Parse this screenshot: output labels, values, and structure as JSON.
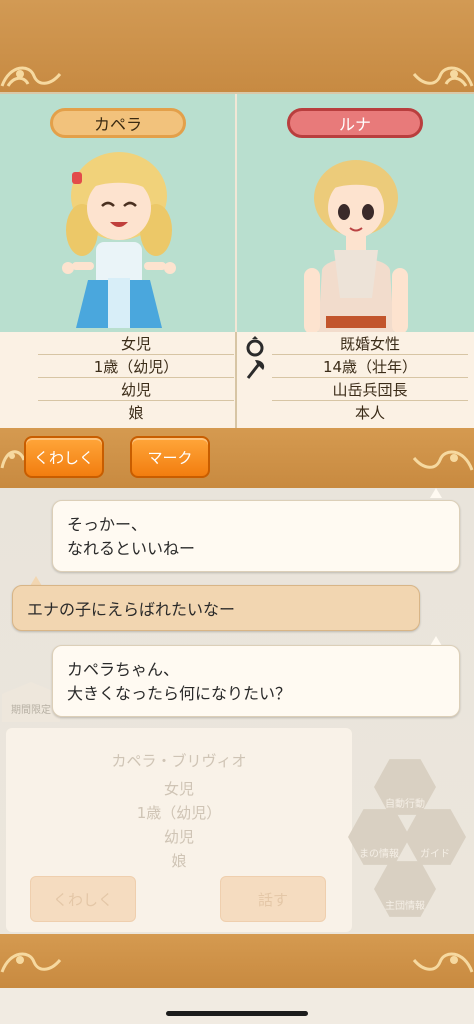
{
  "characters": {
    "left": {
      "name": "カペラ",
      "info": [
        "女児",
        "1歳（幼児）",
        "幼児",
        "娘"
      ]
    },
    "right": {
      "name": "ルナ",
      "info": [
        "既婚女性",
        "14歳（壮年）",
        "山岳兵団長",
        "本人"
      ]
    }
  },
  "icons": {
    "ring": "ring-icon",
    "axe": "axe-icon"
  },
  "buttons": {
    "details": "くわしく",
    "mark": "マーク"
  },
  "chat": {
    "messages": [
      {
        "speaker": "other",
        "lines": [
          "そっかー、",
          "なれるといいねー"
        ]
      },
      {
        "speaker": "self",
        "lines": [
          "エナの子にえらばれたいなー"
        ]
      },
      {
        "speaker": "other",
        "lines": [
          "カペラちゃん、",
          "大きくなったら何になりたい？"
        ]
      }
    ]
  },
  "background_panel": {
    "badge": "期間限定",
    "name": "カペラ・ブリヴィオ",
    "info": [
      "女児",
      "1歳（幼児）",
      "幼児",
      "娘"
    ],
    "details_button": "くわしく",
    "talk_button": "話す"
  },
  "side_menu": {
    "auto_action": "自動行動",
    "guide": "ガイド",
    "item3": "まの情報",
    "item4": "主団情報"
  },
  "colors": {
    "frame": "#c98b43",
    "portrait_bg": "#b9dfcf",
    "accent_orange": "#f58a17",
    "name_left": "#f2c27c",
    "name_right": "#e87a7a"
  }
}
